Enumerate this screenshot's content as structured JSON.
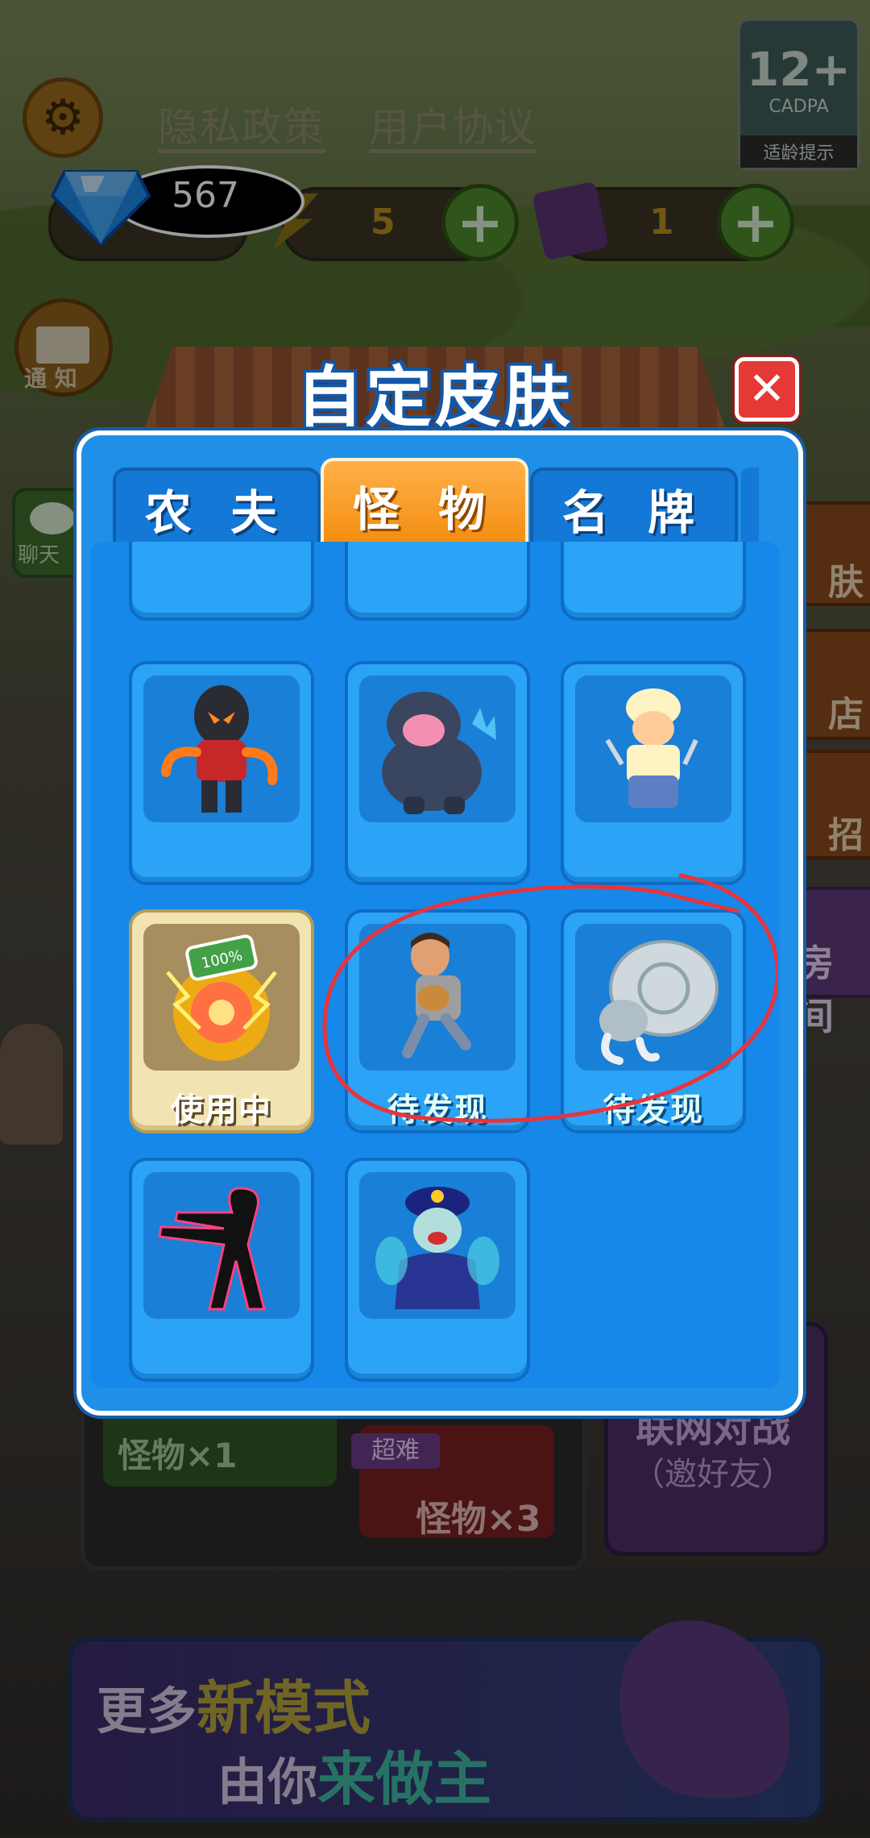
{
  "top_links": {
    "privacy": "隐私政策",
    "agreement": "用户协议"
  },
  "age_badge": {
    "rating": "12+",
    "org": "CADPA",
    "tip": "适龄提示"
  },
  "resources": {
    "gems": "567",
    "energy": "5",
    "tickets": "1"
  },
  "left_buttons": {
    "mail_label": "通 知",
    "chat_label": "聊天"
  },
  "right_buttons": {
    "skin_label": "肤",
    "shop_label": "店",
    "recruit_label": "招",
    "room_label": "房间"
  },
  "modes": {
    "mode1": "怪物×1",
    "hard_tag": "超难",
    "mode2": "怪物×3",
    "online_title": "联网对战",
    "online_sub": "（邀好友）"
  },
  "banner": {
    "line1_a": "更多",
    "line1_b": "新模式",
    "line2_a": "由你",
    "line2_b": "来做主"
  },
  "modal": {
    "title": "自定皮肤",
    "tabs": [
      {
        "label": "农 夫",
        "active": false
      },
      {
        "label": "怪 物",
        "active": true
      },
      {
        "label": "名 牌",
        "active": false
      }
    ],
    "cards": [
      {
        "name": "lava-ninja",
        "status": ""
      },
      {
        "name": "kaiju",
        "status": ""
      },
      {
        "name": "claw-fighter",
        "status": ""
      },
      {
        "name": "energy-orb",
        "status": "使用中",
        "badge": "100%"
      },
      {
        "name": "running-man",
        "status": "待发现"
      },
      {
        "name": "armored-crab",
        "status": "待发现"
      },
      {
        "name": "shadow-figure",
        "status": ""
      },
      {
        "name": "jiangshi",
        "status": ""
      }
    ]
  },
  "colors": {
    "panel": "#1f8fe8",
    "active_tab": "#f28a0c",
    "close": "#e53935",
    "annotation": "#e8343c"
  }
}
